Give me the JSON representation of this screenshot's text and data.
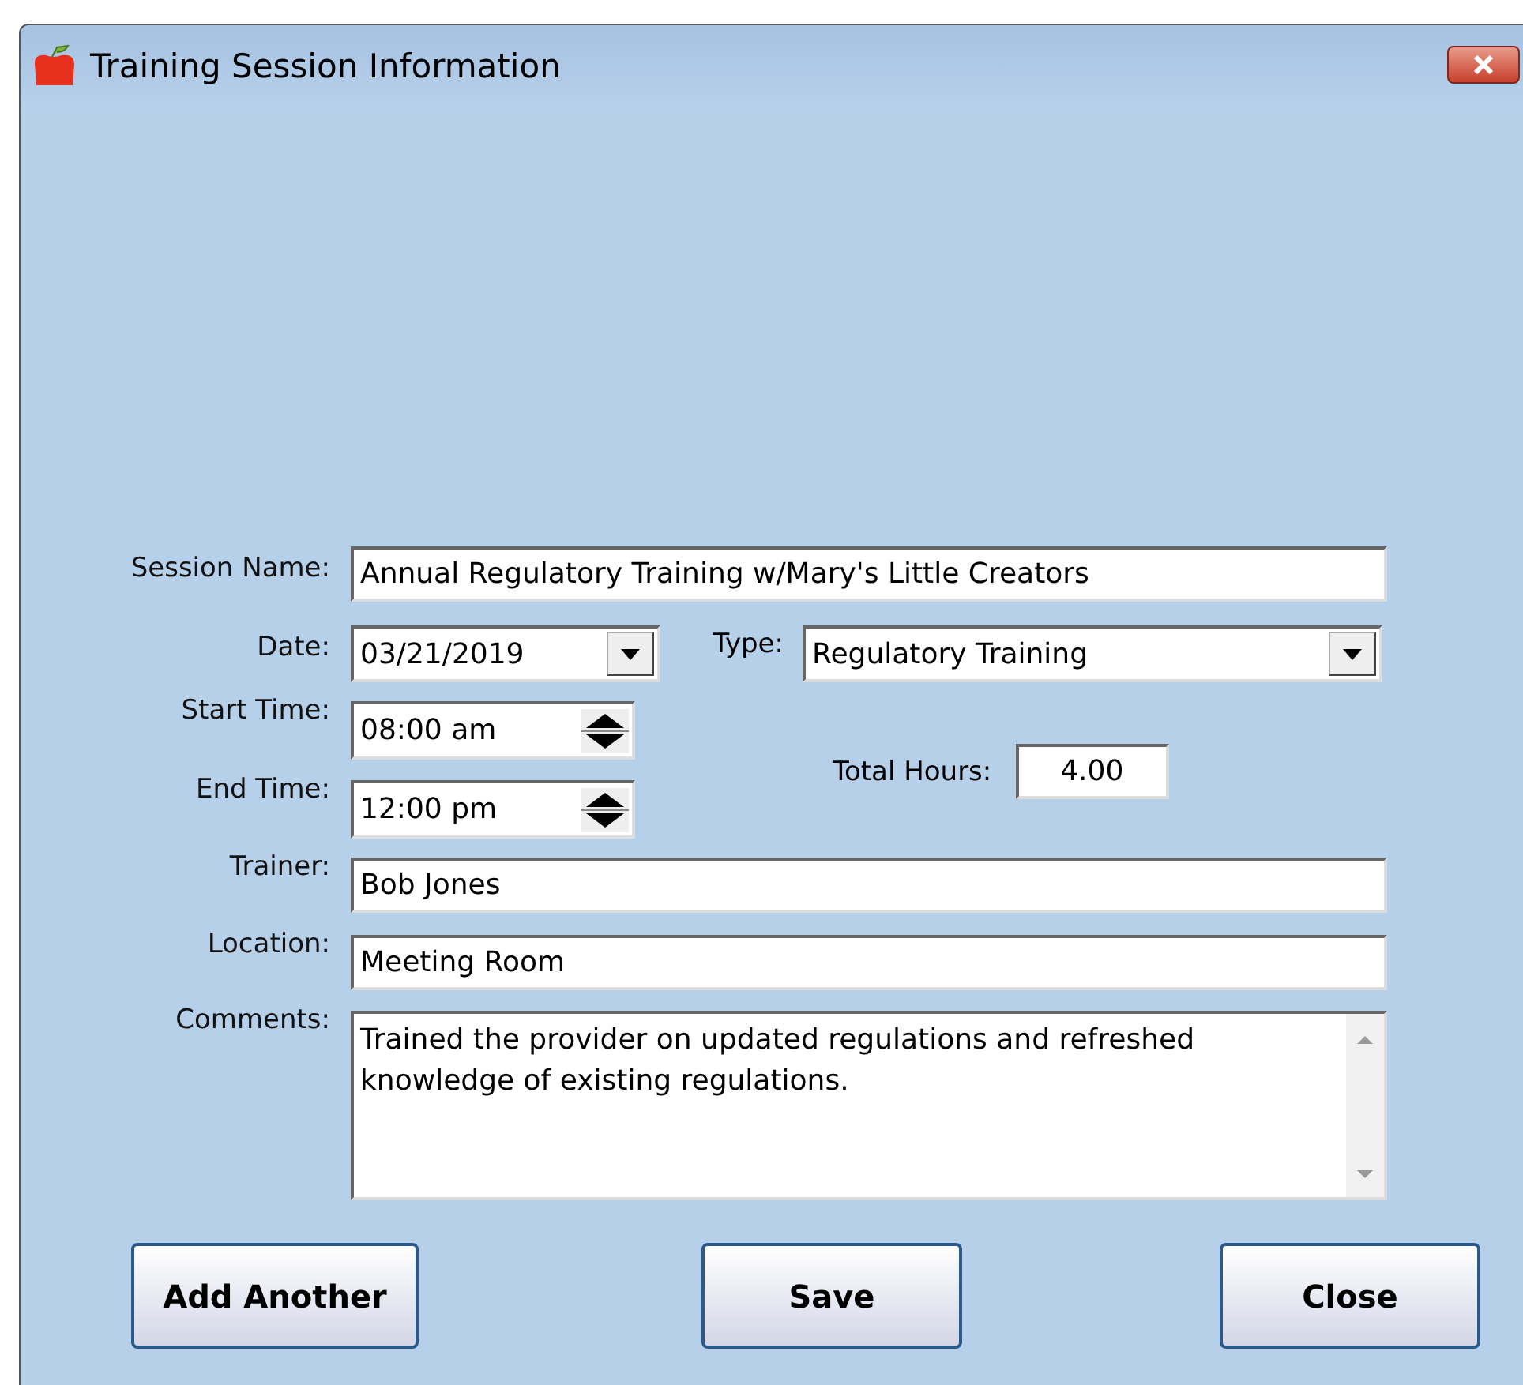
{
  "window": {
    "title": "Training Session Information"
  },
  "form": {
    "session_name": {
      "label": "Session Name:",
      "value": "Annual Regulatory Training w/Mary's Little Creators"
    },
    "date": {
      "label": "Date:",
      "value": "03/21/2019"
    },
    "type": {
      "label": "Type:",
      "value": "Regulatory Training"
    },
    "start_time": {
      "label": "Start Time:",
      "value": "08:00 am"
    },
    "end_time": {
      "label": "End Time:",
      "value": "12:00 pm"
    },
    "total_hours": {
      "label": "Total Hours:",
      "value": "4.00"
    },
    "trainer": {
      "label": "Trainer:",
      "value": "Bob Jones"
    },
    "location": {
      "label": "Location:",
      "value": "Meeting Room"
    },
    "comments": {
      "label": "Comments:",
      "value": "Trained the provider on updated regulations and refreshed knowledge of existing regulations."
    }
  },
  "buttons": [
    "Add Another",
    "Save",
    "Close"
  ]
}
